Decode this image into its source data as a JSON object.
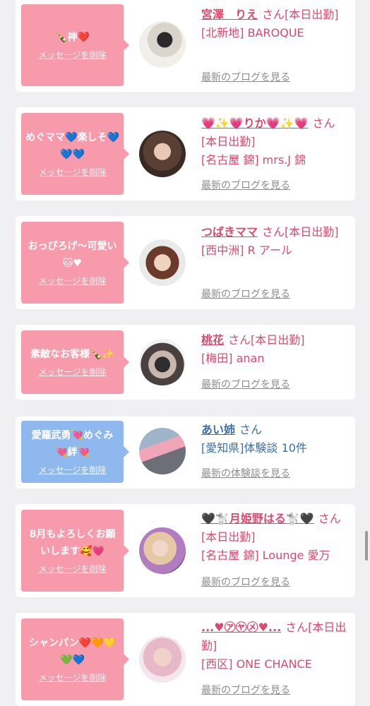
{
  "delete_label": "メッセージを削除",
  "blog_link": "最新のブログを見る",
  "review_link": "最新の体験談を見る",
  "colors": {
    "pink_bubble": "#f79aab",
    "blue_bubble": "#8fb8ee",
    "pink_text": "#d94a6e",
    "blue_text": "#3a6ea8",
    "link_gray": "#8c8c8c"
  },
  "cards": [
    {
      "message": "🍾神❤️",
      "name": "宮澤　りえ",
      "suffix": "さん[本日出勤]",
      "location": "[北新地] BAROQUE"
    },
    {
      "message": "めぐママ💙楽しそ💙💙💙",
      "name": "💗✨💗りか💗✨💗",
      "suffix": "さん[本日出勤]",
      "location": "[名古屋 錦] mrs.J 錦"
    },
    {
      "message": "おっぴろげ〜可愛い🐱♥",
      "name": "つばきママ",
      "suffix": "さん[本日出勤]",
      "location": "[西中洲] R アール"
    },
    {
      "message": "素敵なお客様🍾✨",
      "name": "桃花",
      "suffix": "さん[本日出勤]",
      "location": "[梅田] anan"
    },
    {
      "message": "愛羅武勇💘めぐみ💘絆💘",
      "name": "あい姉",
      "suffix": "さん",
      "location": "[愛知県]体験談 10件"
    },
    {
      "message": "8月もよろしくお願いします🥰💗",
      "name": "🖤🐩月姫野はる🐩🖤",
      "suffix": "さん[本日出勤]",
      "location": "[名古屋 錦] Lounge 愛万"
    },
    {
      "message": "シャンパン❤️🧡💛💚💙",
      "name": "...♥㋐㋳㋱♥...",
      "suffix": "さん[本日出勤]",
      "location": "[西区] ONE CHANCE"
    }
  ]
}
